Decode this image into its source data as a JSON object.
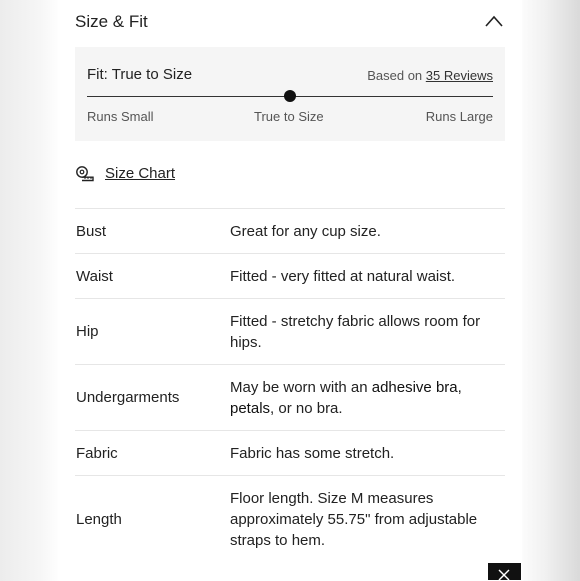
{
  "header": {
    "title": "Size & Fit"
  },
  "fit": {
    "title": "Fit: True to Size",
    "based_on_prefix": "Based on",
    "reviews_link": "35 Reviews",
    "scale_position": 0.5,
    "scale_labels": {
      "small": "Runs Small",
      "true": "True to Size",
      "large": "Runs Large"
    }
  },
  "size_chart": {
    "label": "Size Chart",
    "icon": "measuring-tape-icon"
  },
  "specs": [
    {
      "key": "Bust",
      "value": "Great for any cup size."
    },
    {
      "key": "Waist",
      "value": "Fitted - very fitted at natural waist."
    },
    {
      "key": "Hip",
      "value": "Fitted - stretchy fabric allows room for hips."
    },
    {
      "key": "Undergarments",
      "value_parts": [
        "May be worn with an ",
        "adhesive bra",
        ", ",
        "petals",
        ", or no bra."
      ]
    },
    {
      "key": "Fabric",
      "value": "Fabric has some stretch."
    },
    {
      "key": "Length",
      "value": "Floor length. Size M measures approximately 55.75\" from adjustable straps to hem."
    }
  ]
}
